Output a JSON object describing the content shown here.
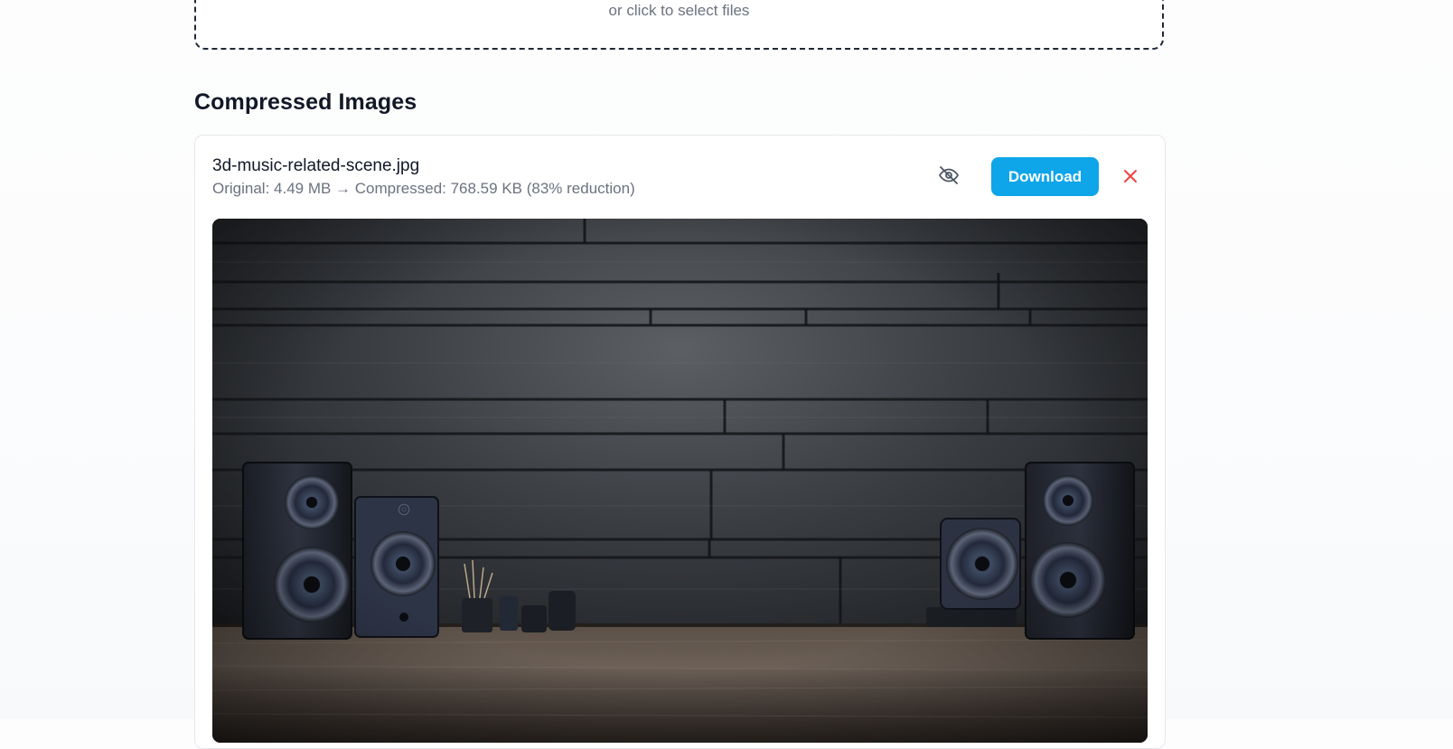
{
  "dropzone": {
    "hint": "or click to select files"
  },
  "section": {
    "title": "Compressed Images"
  },
  "image_card": {
    "file_name": "3d-music-related-scene.jpg",
    "stats": "Original: 4.49 MB → Compressed: 768.59 KB (83% reduction)",
    "download_label": "Download",
    "toggle_icon": "eye-off-icon",
    "remove_icon": "close-icon",
    "preview_description": "3D render of studio speakers on a wooden desk against a dark plank wall"
  },
  "colors": {
    "accent": "#0ea5e9",
    "remove": "#ef4444",
    "muted_text": "#6b7280",
    "heading_text": "#111827"
  }
}
